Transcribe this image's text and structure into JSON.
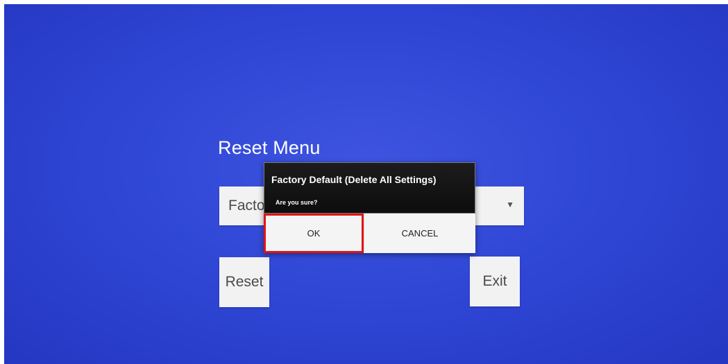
{
  "screen": {
    "title": "Reset Menu",
    "dropdown": {
      "value": "Factory Default (Delete All Settings)",
      "arrow_icon": "dropdown-arrow-icon"
    },
    "buttons": {
      "reset_label": "Reset",
      "exit_label": "Exit"
    }
  },
  "dialog": {
    "title": "Factory Default (Delete All Settings)",
    "message": "Are you sure?",
    "ok_label": "OK",
    "cancel_label": "CANCEL",
    "highlight_color": "#e01414"
  },
  "colors": {
    "background": "#3047d6",
    "dialog_header": "#111111"
  }
}
